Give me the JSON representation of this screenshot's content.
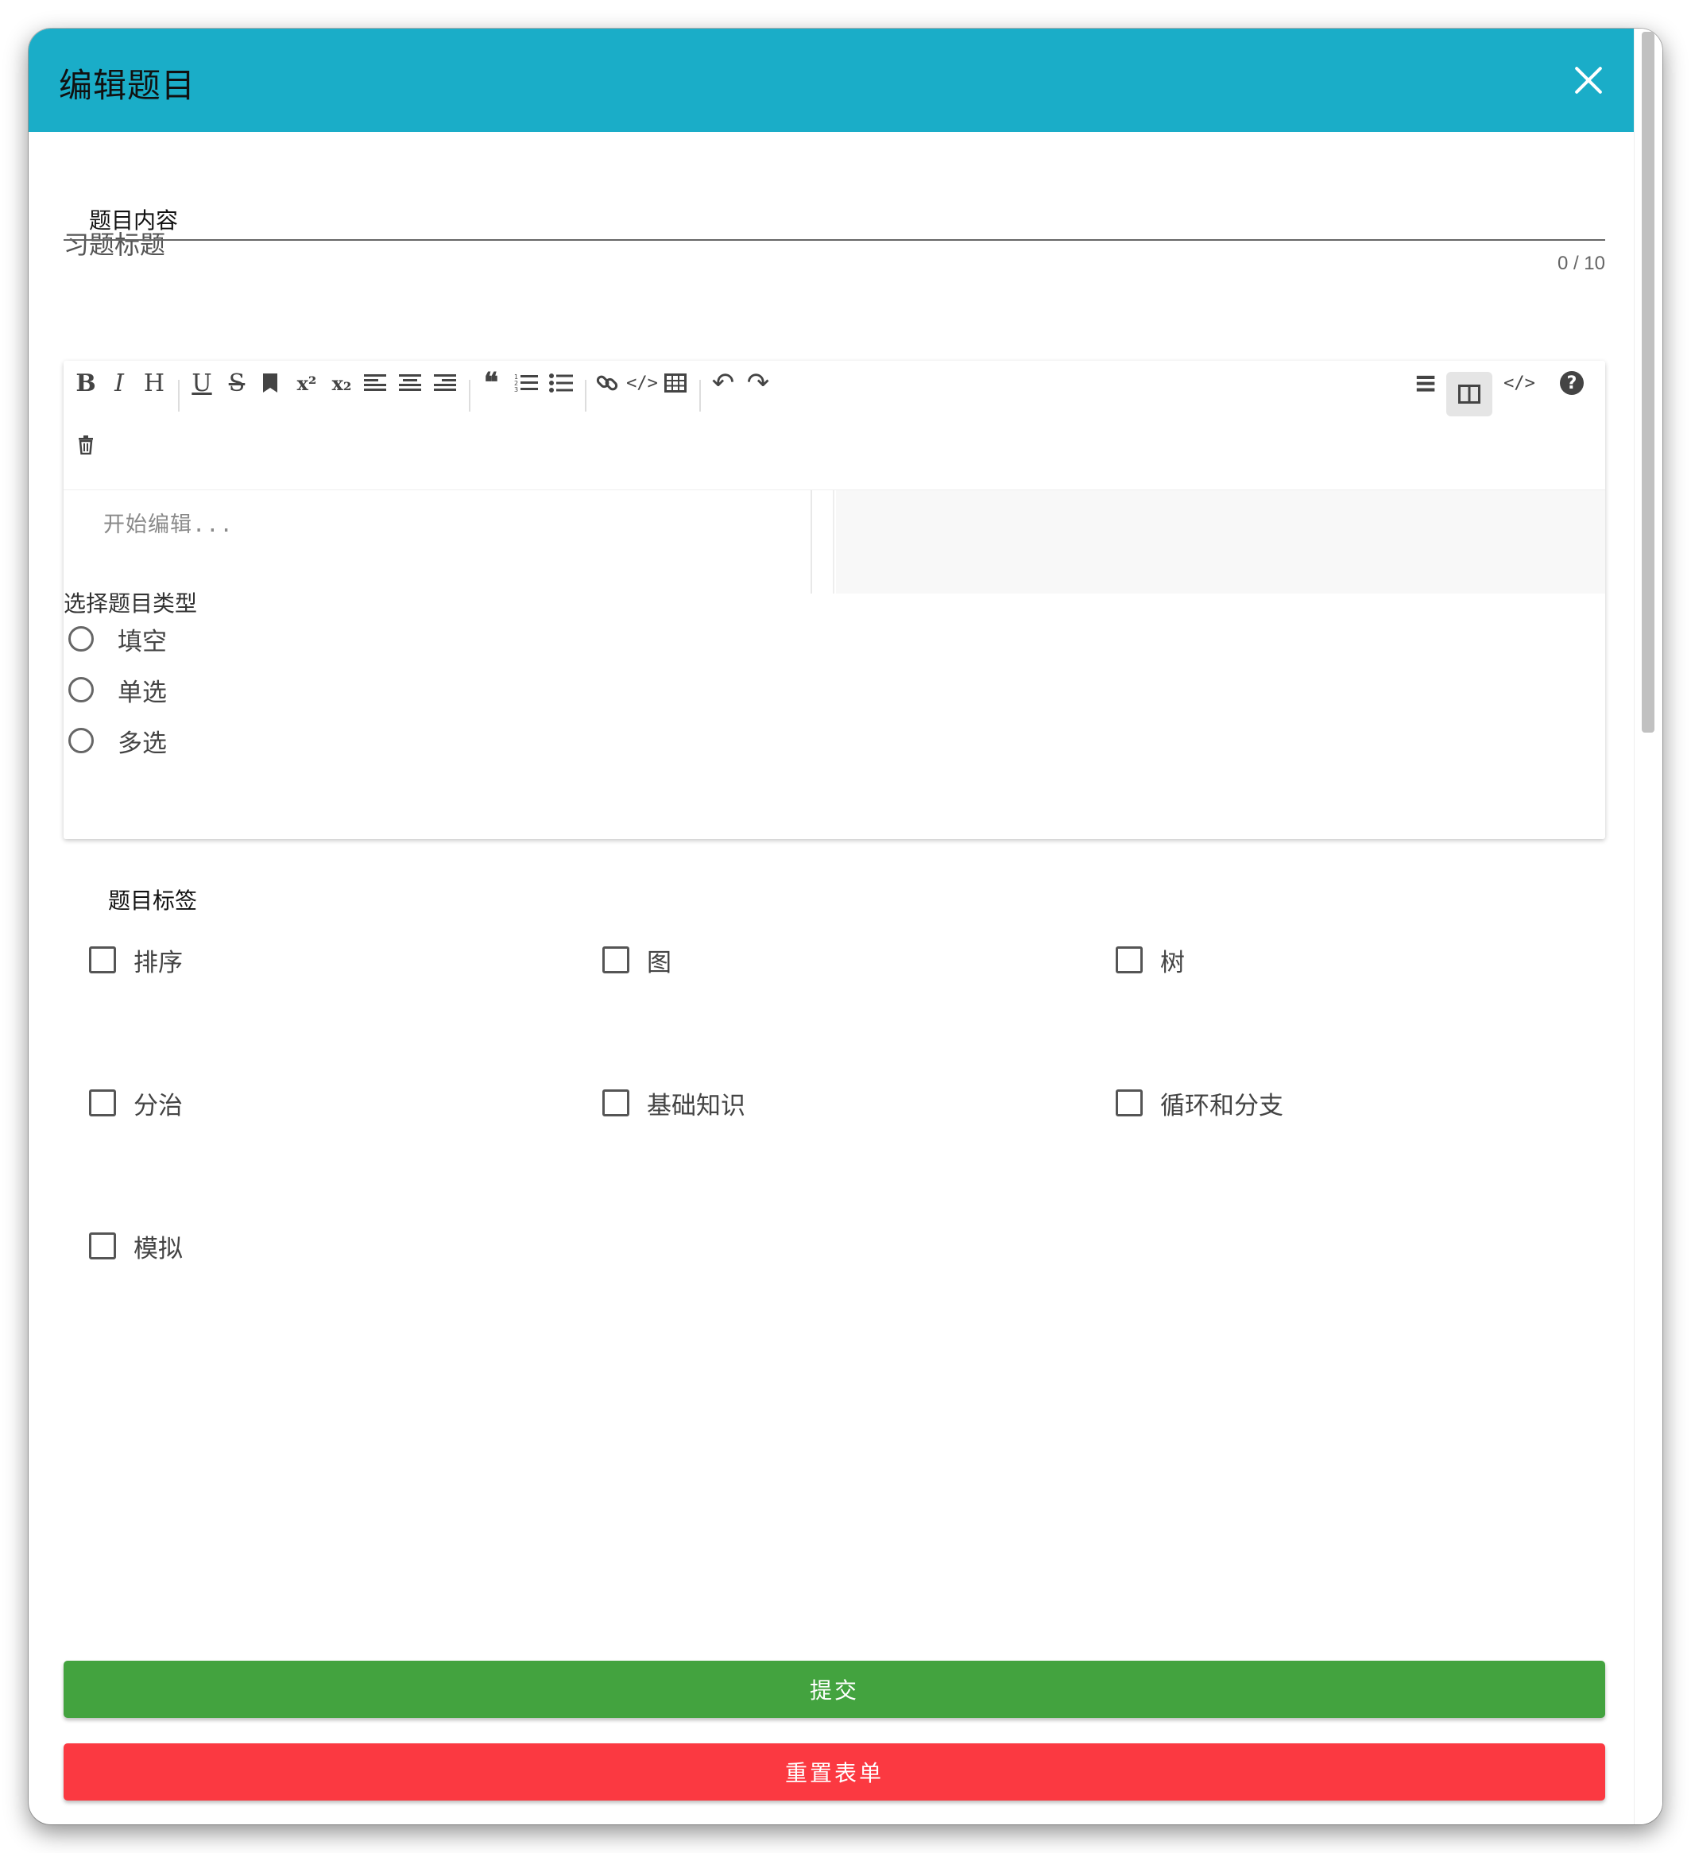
{
  "dialog": {
    "title": "编辑题目",
    "close_icon": "close-icon"
  },
  "title_field": {
    "placeholder": "习题标题",
    "value": "",
    "counter": "0 / 10"
  },
  "content": {
    "label": "题目内容",
    "editor_placeholder": "开始编辑...",
    "toolbar": [
      {
        "name": "bold-icon",
        "glyph": "B"
      },
      {
        "name": "italic-icon",
        "glyph": "I"
      },
      {
        "name": "heading-icon",
        "glyph": "H"
      },
      {
        "name": "underline-icon",
        "glyph": "U"
      },
      {
        "name": "strikethrough-icon",
        "glyph": "S"
      },
      {
        "name": "mark-icon",
        "glyph": ""
      },
      {
        "name": "superscript-icon",
        "glyph": "x²"
      },
      {
        "name": "subscript-icon",
        "glyph": "x₂"
      },
      {
        "name": "align-left-icon",
        "glyph": ""
      },
      {
        "name": "align-center-icon",
        "glyph": ""
      },
      {
        "name": "align-right-icon",
        "glyph": ""
      },
      {
        "name": "quote-icon",
        "glyph": "❝"
      },
      {
        "name": "ordered-list-icon",
        "glyph": ""
      },
      {
        "name": "unordered-list-icon",
        "glyph": ""
      },
      {
        "name": "link-icon",
        "glyph": ""
      },
      {
        "name": "code-block-icon",
        "glyph": "</>"
      },
      {
        "name": "table-icon",
        "glyph": ""
      },
      {
        "name": "undo-icon",
        "glyph": "↶"
      },
      {
        "name": "redo-icon",
        "glyph": "↷"
      },
      {
        "name": "navigation-icon",
        "glyph": "≡"
      },
      {
        "name": "subfield-icon",
        "glyph": ""
      },
      {
        "name": "html-code-icon",
        "glyph": "</>"
      },
      {
        "name": "help-icon",
        "glyph": "?"
      },
      {
        "name": "trash-icon",
        "glyph": ""
      }
    ]
  },
  "question_type": {
    "label": "选择题目类型",
    "options": [
      "填空",
      "单选",
      "多选"
    ]
  },
  "tags": {
    "label": "题目标签",
    "items": [
      "排序",
      "图",
      "树",
      "分治",
      "基础知识",
      "循环和分支",
      "模拟"
    ]
  },
  "actions": {
    "submit": "提交",
    "reset": "重置表单"
  },
  "colors": {
    "header": "#1aadc8",
    "submit": "#43a33f",
    "reset": "#fb3941"
  }
}
